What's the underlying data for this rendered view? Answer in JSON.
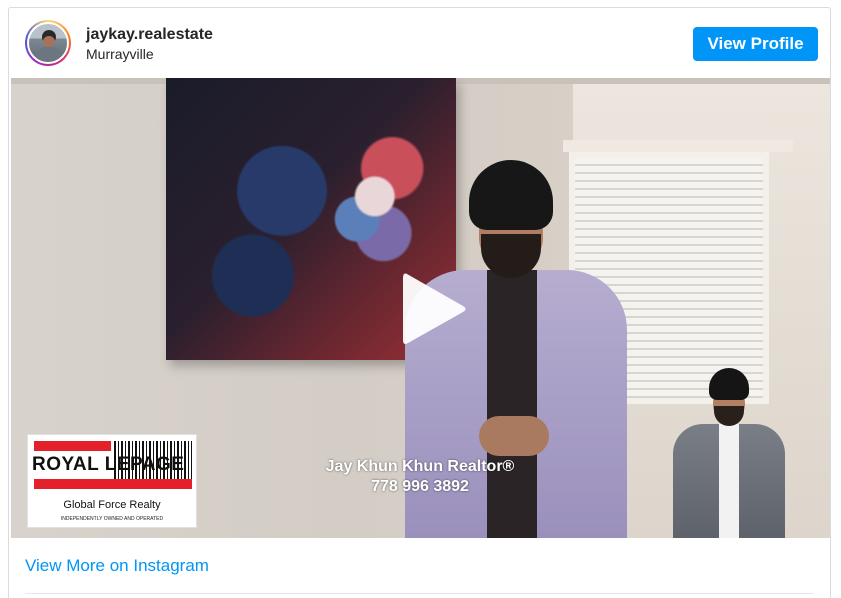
{
  "profile": {
    "username": "jaykay.realestate",
    "location": "Murrayville",
    "view_profile_label": "View Profile"
  },
  "media": {
    "overlay_name": "Jay Khun Khun Realtor®",
    "overlay_phone": "778 996 3892",
    "logo": {
      "brand": "ROYAL LEPAGE",
      "subtitle": "Global Force Realty",
      "tagline": "INDEPENDENTLY OWNED AND OPERATED"
    }
  },
  "footer": {
    "view_more_label": "View More on Instagram"
  },
  "colors": {
    "accent": "#0095f6",
    "logo_red": "#e4212b"
  }
}
